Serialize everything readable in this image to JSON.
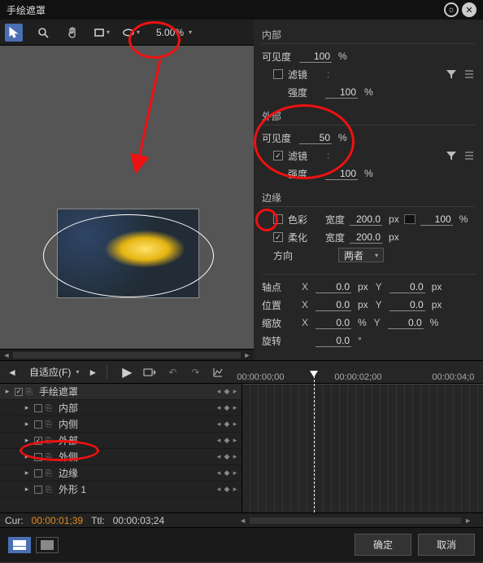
{
  "title": "手绘遮罩",
  "toolbar": {
    "zoom": "5.00%"
  },
  "props": {
    "inner": {
      "title": "内部",
      "visibility_label": "可见度",
      "visibility_value": "100",
      "visibility_unit": "%",
      "filter_label": "滤镜",
      "strength_label": "强度",
      "strength_value": "100",
      "strength_unit": "%"
    },
    "outer": {
      "title": "外部",
      "visibility_label": "可见度",
      "visibility_value": "50",
      "visibility_unit": "%",
      "filter_label": "滤镜",
      "strength_label": "强度",
      "strength_value": "100",
      "strength_unit": "%"
    },
    "edge": {
      "title": "边缘",
      "color_label": "色彩",
      "width_label": "宽度",
      "color_width_value": "200.0",
      "color_width_unit": "px",
      "color_percent_value": "100",
      "color_percent_unit": "%",
      "soft_label": "柔化",
      "soft_width_value": "200.0",
      "soft_width_unit": "px",
      "direction_label": "方向",
      "direction_value": "两者"
    },
    "transform": {
      "pivot_label": "轴点",
      "position_label": "位置",
      "scale_label": "缩放",
      "rotation_label": "旋转",
      "pivot_x": "0.0",
      "pivot_y": "0.0",
      "pivot_unit": "px",
      "position_x": "0.0",
      "position_y": "0.0",
      "position_unit": "px",
      "scale_x": "0.0",
      "scale_y": "0.0",
      "scale_unit": "%",
      "rotation_value": "0.0",
      "rotation_unit": "°"
    }
  },
  "timeline": {
    "fit": "自适应(F)",
    "ruler": {
      "t0": "00:00:00;00",
      "t1": "00:00:02;00",
      "t2": "00:00:04;0"
    },
    "tracks": [
      {
        "name": "手绘遮罩",
        "checked": true,
        "indent": 0,
        "parent": true
      },
      {
        "name": "内部",
        "checked": false,
        "indent": 1
      },
      {
        "name": "内侧",
        "checked": false,
        "indent": 1
      },
      {
        "name": "外部",
        "checked": true,
        "indent": 1
      },
      {
        "name": "外侧",
        "checked": false,
        "indent": 1
      },
      {
        "name": "边缘",
        "checked": false,
        "indent": 1
      },
      {
        "name": "外形 1",
        "checked": false,
        "indent": 1
      }
    ],
    "status": {
      "cur_label": "Cur:",
      "cur_value": "00:00:01;39",
      "ttl_label": "Ttl:",
      "ttl_value": "00:00:03;24"
    }
  },
  "footer": {
    "ok": "确定",
    "cancel": "取消"
  }
}
